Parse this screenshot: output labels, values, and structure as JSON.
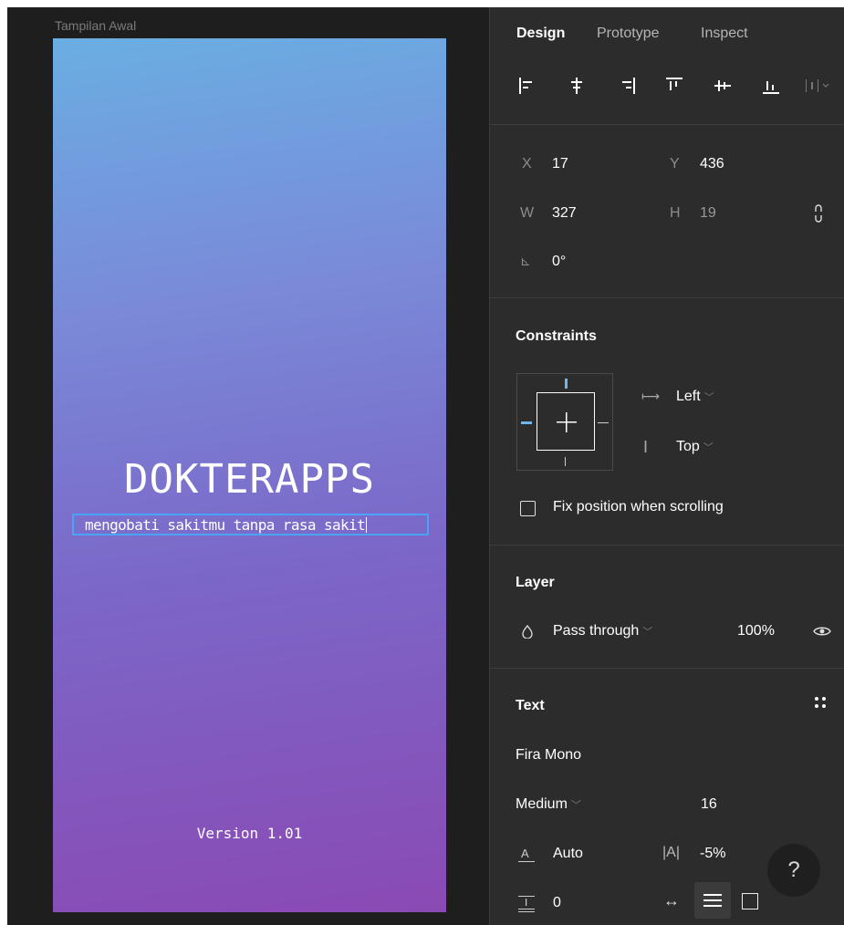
{
  "canvas": {
    "frame_label": "Tampilan Awal",
    "app_title": "DOKTERAPPS",
    "tagline": "mengobati sakitmu tanpa rasa sakit",
    "version": "Version 1.01"
  },
  "tabs": {
    "design": "Design",
    "prototype": "Prototype",
    "inspect": "Inspect"
  },
  "alignment_icons": [
    "align-left-icon",
    "align-horizontal-center-icon",
    "align-right-icon",
    "align-top-icon",
    "align-vertical-center-icon",
    "align-bottom-icon",
    "distribute-icon"
  ],
  "transform": {
    "x_label": "X",
    "x_value": "17",
    "y_label": "Y",
    "y_value": "436",
    "w_label": "W",
    "w_value": "327",
    "h_label": "H",
    "h_value": "19",
    "rotation_label": "⊾",
    "rotation_value": "0°"
  },
  "constraints": {
    "title": "Constraints",
    "horizontal": "Left",
    "vertical": "Top",
    "fix_position_label": "Fix position when scrolling"
  },
  "layer": {
    "title": "Layer",
    "blend_mode": "Pass through",
    "opacity": "100%"
  },
  "text": {
    "title": "Text",
    "font_family": "Fira Mono",
    "font_weight": "Medium",
    "font_size": "16",
    "line_height": "Auto",
    "letter_spacing": "-5%",
    "paragraph_spacing": "0",
    "help": "?"
  },
  "colors": {
    "canvas_bg": "#1e1e1e",
    "panel_bg": "#2c2c2c",
    "selection": "#4ba3f5",
    "gradient_top": "#6aaee3",
    "gradient_bottom": "#8a4ab4"
  }
}
